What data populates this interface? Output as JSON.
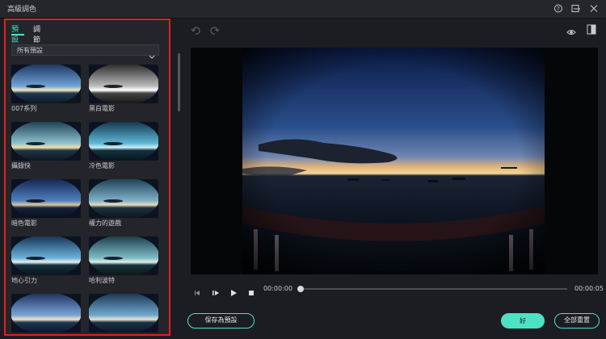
{
  "window": {
    "title": "高級調色"
  },
  "panel": {
    "tabs": [
      "預設",
      "調節"
    ],
    "dropdown_value": "所有預設",
    "presets": [
      "007系列",
      "黑白電影",
      "攝錄快",
      "冷色電影",
      "暗色電影",
      "權力的遊戲",
      "地心引力",
      "哈利波特",
      "",
      ""
    ]
  },
  "player": {
    "current_time": "00:00:00",
    "total_time": "00:00:05",
    "progress": 0
  },
  "buttons": {
    "save_preset": "保存為預設",
    "ok": "好",
    "reset_all": "全部重置"
  },
  "colors": {
    "accent": "#4ee2c4",
    "highlight_border": "#e0201f"
  },
  "icons": [
    "help-icon",
    "minimize-icon",
    "maximize-icon",
    "close-icon",
    "undo-icon",
    "redo-icon",
    "eye-icon",
    "compare-icon",
    "frame-back-icon",
    "frame-forward-icon",
    "play-icon",
    "stop-icon"
  ]
}
